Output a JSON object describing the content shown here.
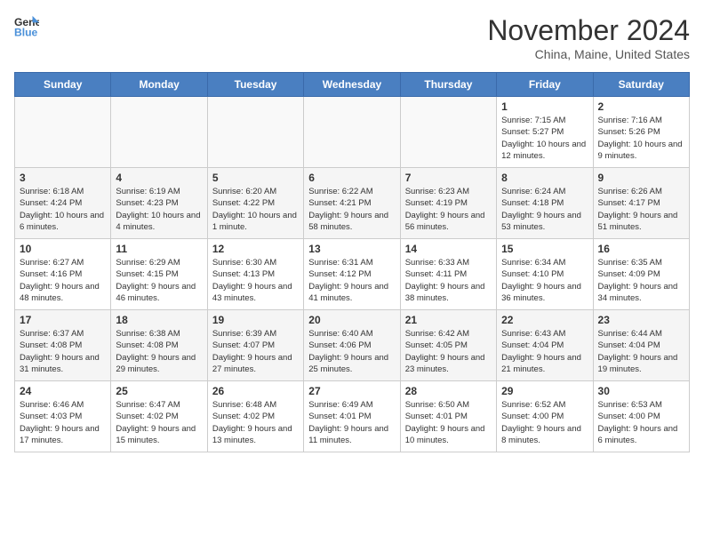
{
  "header": {
    "logo_general": "General",
    "logo_blue": "Blue",
    "month_title": "November 2024",
    "location": "China, Maine, United States"
  },
  "days_of_week": [
    "Sunday",
    "Monday",
    "Tuesday",
    "Wednesday",
    "Thursday",
    "Friday",
    "Saturday"
  ],
  "weeks": [
    [
      {
        "day": "",
        "info": ""
      },
      {
        "day": "",
        "info": ""
      },
      {
        "day": "",
        "info": ""
      },
      {
        "day": "",
        "info": ""
      },
      {
        "day": "",
        "info": ""
      },
      {
        "day": "1",
        "info": "Sunrise: 7:15 AM\nSunset: 5:27 PM\nDaylight: 10 hours and 12 minutes."
      },
      {
        "day": "2",
        "info": "Sunrise: 7:16 AM\nSunset: 5:26 PM\nDaylight: 10 hours and 9 minutes."
      }
    ],
    [
      {
        "day": "3",
        "info": "Sunrise: 6:18 AM\nSunset: 4:24 PM\nDaylight: 10 hours and 6 minutes."
      },
      {
        "day": "4",
        "info": "Sunrise: 6:19 AM\nSunset: 4:23 PM\nDaylight: 10 hours and 4 minutes."
      },
      {
        "day": "5",
        "info": "Sunrise: 6:20 AM\nSunset: 4:22 PM\nDaylight: 10 hours and 1 minute."
      },
      {
        "day": "6",
        "info": "Sunrise: 6:22 AM\nSunset: 4:21 PM\nDaylight: 9 hours and 58 minutes."
      },
      {
        "day": "7",
        "info": "Sunrise: 6:23 AM\nSunset: 4:19 PM\nDaylight: 9 hours and 56 minutes."
      },
      {
        "day": "8",
        "info": "Sunrise: 6:24 AM\nSunset: 4:18 PM\nDaylight: 9 hours and 53 minutes."
      },
      {
        "day": "9",
        "info": "Sunrise: 6:26 AM\nSunset: 4:17 PM\nDaylight: 9 hours and 51 minutes."
      }
    ],
    [
      {
        "day": "10",
        "info": "Sunrise: 6:27 AM\nSunset: 4:16 PM\nDaylight: 9 hours and 48 minutes."
      },
      {
        "day": "11",
        "info": "Sunrise: 6:29 AM\nSunset: 4:15 PM\nDaylight: 9 hours and 46 minutes."
      },
      {
        "day": "12",
        "info": "Sunrise: 6:30 AM\nSunset: 4:13 PM\nDaylight: 9 hours and 43 minutes."
      },
      {
        "day": "13",
        "info": "Sunrise: 6:31 AM\nSunset: 4:12 PM\nDaylight: 9 hours and 41 minutes."
      },
      {
        "day": "14",
        "info": "Sunrise: 6:33 AM\nSunset: 4:11 PM\nDaylight: 9 hours and 38 minutes."
      },
      {
        "day": "15",
        "info": "Sunrise: 6:34 AM\nSunset: 4:10 PM\nDaylight: 9 hours and 36 minutes."
      },
      {
        "day": "16",
        "info": "Sunrise: 6:35 AM\nSunset: 4:09 PM\nDaylight: 9 hours and 34 minutes."
      }
    ],
    [
      {
        "day": "17",
        "info": "Sunrise: 6:37 AM\nSunset: 4:08 PM\nDaylight: 9 hours and 31 minutes."
      },
      {
        "day": "18",
        "info": "Sunrise: 6:38 AM\nSunset: 4:08 PM\nDaylight: 9 hours and 29 minutes."
      },
      {
        "day": "19",
        "info": "Sunrise: 6:39 AM\nSunset: 4:07 PM\nDaylight: 9 hours and 27 minutes."
      },
      {
        "day": "20",
        "info": "Sunrise: 6:40 AM\nSunset: 4:06 PM\nDaylight: 9 hours and 25 minutes."
      },
      {
        "day": "21",
        "info": "Sunrise: 6:42 AM\nSunset: 4:05 PM\nDaylight: 9 hours and 23 minutes."
      },
      {
        "day": "22",
        "info": "Sunrise: 6:43 AM\nSunset: 4:04 PM\nDaylight: 9 hours and 21 minutes."
      },
      {
        "day": "23",
        "info": "Sunrise: 6:44 AM\nSunset: 4:04 PM\nDaylight: 9 hours and 19 minutes."
      }
    ],
    [
      {
        "day": "24",
        "info": "Sunrise: 6:46 AM\nSunset: 4:03 PM\nDaylight: 9 hours and 17 minutes."
      },
      {
        "day": "25",
        "info": "Sunrise: 6:47 AM\nSunset: 4:02 PM\nDaylight: 9 hours and 15 minutes."
      },
      {
        "day": "26",
        "info": "Sunrise: 6:48 AM\nSunset: 4:02 PM\nDaylight: 9 hours and 13 minutes."
      },
      {
        "day": "27",
        "info": "Sunrise: 6:49 AM\nSunset: 4:01 PM\nDaylight: 9 hours and 11 minutes."
      },
      {
        "day": "28",
        "info": "Sunrise: 6:50 AM\nSunset: 4:01 PM\nDaylight: 9 hours and 10 minutes."
      },
      {
        "day": "29",
        "info": "Sunrise: 6:52 AM\nSunset: 4:00 PM\nDaylight: 9 hours and 8 minutes."
      },
      {
        "day": "30",
        "info": "Sunrise: 6:53 AM\nSunset: 4:00 PM\nDaylight: 9 hours and 6 minutes."
      }
    ]
  ]
}
